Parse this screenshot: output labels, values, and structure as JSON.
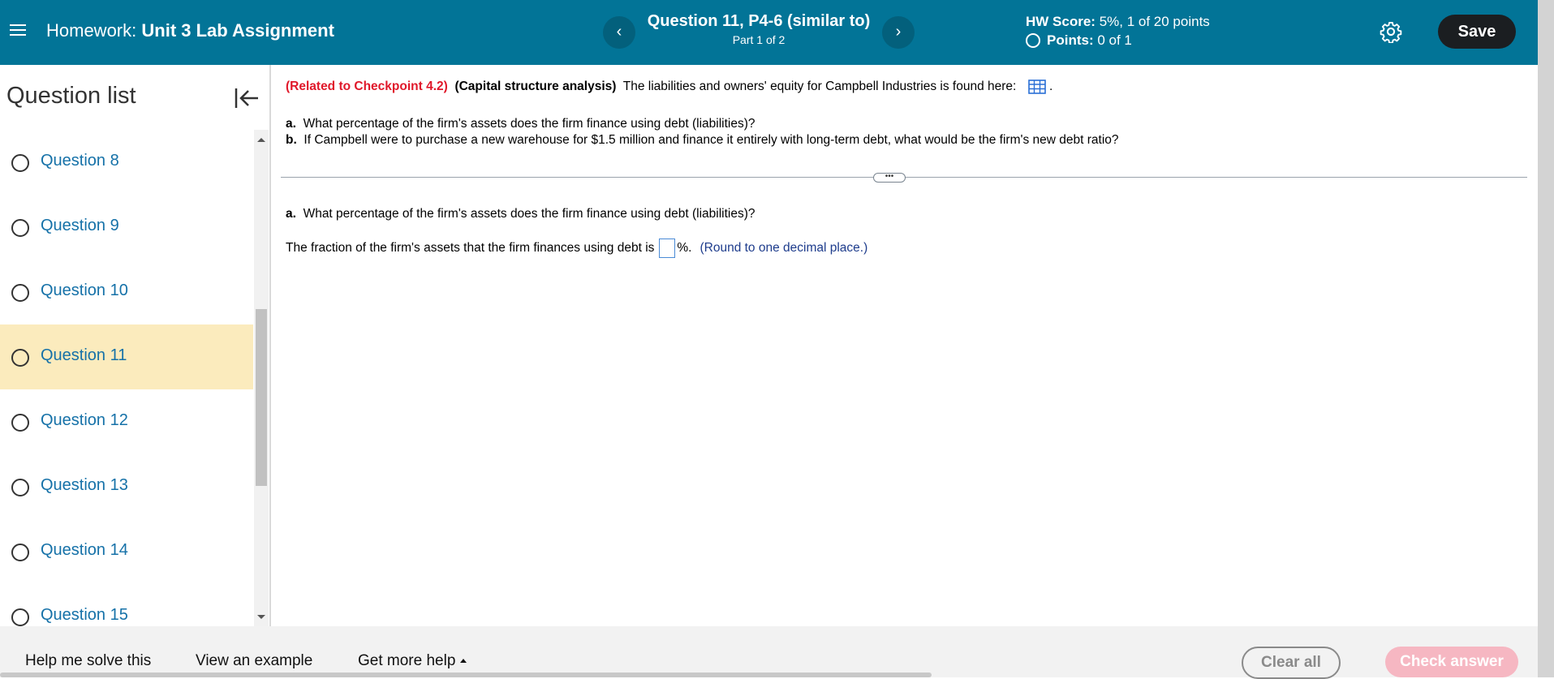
{
  "header": {
    "homework_label": "Homework:",
    "assignment_title": "Unit 3 Lab Assignment",
    "prev_symbol": "‹",
    "next_symbol": "›",
    "question_title": "Question 11, P4-6 (similar to)",
    "part_label": "Part 1 of 2",
    "hw_score_label": "HW Score:",
    "hw_score_value": "5%, 1 of 20 points",
    "points_label": "Points:",
    "points_value": "0 of 1",
    "save_label": "Save",
    "bg_color": "#027497"
  },
  "sidebar": {
    "title": "Question list",
    "active_index": 3,
    "items": [
      {
        "label": "Question 8"
      },
      {
        "label": "Question 9"
      },
      {
        "label": "Question 10"
      },
      {
        "label": "Question 11"
      },
      {
        "label": "Question 12"
      },
      {
        "label": "Question 13"
      },
      {
        "label": "Question 14"
      },
      {
        "label": "Question 15"
      }
    ]
  },
  "question": {
    "related": "(Related to Checkpoint 4.2)",
    "topic": "(Capital structure analysis)",
    "intro_text": "The liabilities and owners' equity for Campbell Industries is found here:",
    "intro_end": ".",
    "a_marker": "a.",
    "a_text": "What percentage of the firm's assets does the firm finance using debt (liabilities)?",
    "b_marker": "b.",
    "b_text": "If Campbell were to purchase a new warehouse for $1.5 million and finance it entirely with long-term debt, what would be the firm's new debt ratio?",
    "grip_symbol": "•••",
    "part_a_marker": "a.",
    "part_a_text": "What percentage of the firm's assets does the firm finance using debt (liabilities)?",
    "answer_prefix": "The fraction of the firm's assets that the firm finances using debt is",
    "answer_value": "",
    "answer_suffix": "%.",
    "hint": "(Round to one decimal place.)"
  },
  "footer": {
    "help_solve": "Help me solve this",
    "view_example": "View an example",
    "more_help": "Get more help",
    "clear_all": "Clear all",
    "check_answer": "Check answer"
  }
}
